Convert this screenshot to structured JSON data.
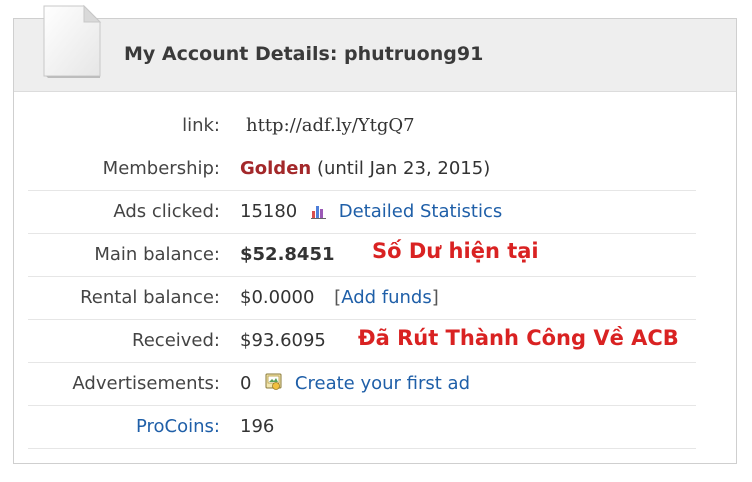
{
  "header": {
    "title": "My Account Details: phutruong91"
  },
  "rows": {
    "link": {
      "label": "link:",
      "value": "http://adf.ly/YtgQ7"
    },
    "membership": {
      "label": "Membership:",
      "level": "Golden",
      "until": "(until Jan 23, 2015)"
    },
    "ads_clicked": {
      "label": "Ads clicked:",
      "count": "15180",
      "link_label": "Detailed Statistics"
    },
    "main_balance": {
      "label": "Main balance:",
      "value": "$52.8451"
    },
    "rental_balance": {
      "label": "Rental balance:",
      "value": "$0.0000",
      "bracket_open": "[",
      "link_label": "Add funds",
      "bracket_close": "]"
    },
    "received": {
      "label": "Received:",
      "value": "$93.6095"
    },
    "advertisements": {
      "label": "Advertisements:",
      "count": "0",
      "link_label": "Create your first ad"
    },
    "procoins": {
      "label": "ProCoins:",
      "value": "196"
    }
  },
  "annotations": {
    "main_balance_note": "Số Dư hiện tại",
    "received_note": "Đã Rút Thành Công Về ACB"
  },
  "colors": {
    "membership": "#a3282a",
    "balance": "#0a8a0a",
    "link": "#1f5fa8",
    "annotation": "#d92222"
  },
  "icons": {
    "header": "document-icon",
    "statistics": "bar-chart-icon",
    "ads": "ad-image-icon"
  }
}
